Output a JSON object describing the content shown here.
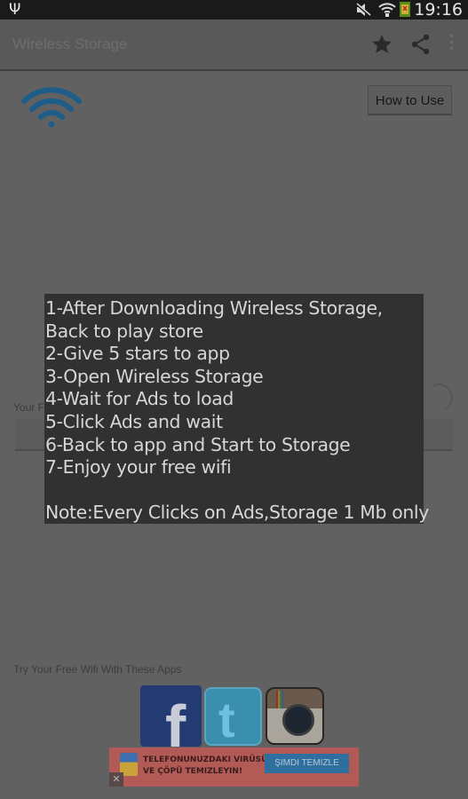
{
  "status_bar": {
    "time": "19:16",
    "icons": [
      "usb-icon",
      "mute-icon",
      "wifi-icon",
      "battery-icon"
    ]
  },
  "action_bar": {
    "title": "Wireless Storage",
    "actions": [
      "star-icon",
      "share-icon",
      "overflow-menu-icon"
    ]
  },
  "main": {
    "how_to_use_label": "How to Use",
    "file_label": "Your F",
    "try_label": "Try Your Free Wifi With These Apps",
    "apps": [
      "Facebook",
      "Twitter",
      "Instagram"
    ]
  },
  "dialog": {
    "lines": [
      "1-After Downloading Wireless Storage,",
      "Back to play store",
      "2-Give 5 stars to app",
      "3-Open Wireless Storage",
      "4-Wait for Ads to load",
      "5-Click Ads and wait",
      "6-Back to app and Start to Storage",
      "7-Enjoy your free wifi",
      "",
      "Note:Every Clicks on Ads,Storage 1 Mb only"
    ]
  },
  "ad": {
    "line1": "TELEFONUNUZDAKI VIRÜSÜ",
    "line2": "VE ÇÖPÜ TEMIZLEYIN!",
    "button": "ŞIMDI TEMIZLE",
    "close": "✕"
  },
  "colors": {
    "wifi_logo": "#1d5d8a",
    "dialog_bg": "#313131",
    "dialog_text": "#d6d6d6"
  }
}
